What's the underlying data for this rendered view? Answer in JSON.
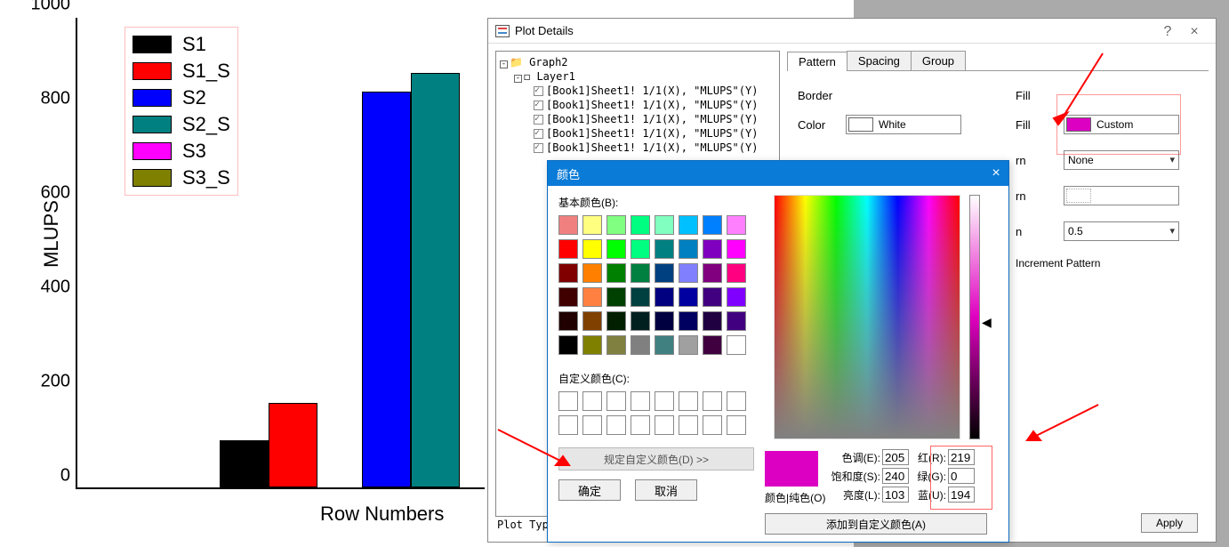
{
  "chart_data": {
    "type": "bar",
    "categories": [
      "S1",
      "S1_S",
      "S2",
      "S2_S",
      "S3",
      "S3_S"
    ],
    "series": [
      {
        "name": "S1",
        "value": 100,
        "color": "#000000"
      },
      {
        "name": "S1_S",
        "value": 180,
        "color": "#ff0000"
      },
      {
        "name": "S2",
        "value": 840,
        "color": "#0000ff"
      },
      {
        "name": "S2_S",
        "value": 880,
        "color": "#008080"
      },
      {
        "name": "S3",
        "value": null,
        "color": "#ff00ff"
      },
      {
        "name": "S3_S",
        "value": null,
        "color": "#808000"
      }
    ],
    "xlabel": "Row Numbers",
    "ylabel": "MLUPS",
    "ylim": [
      0,
      1000
    ],
    "yticks": [
      0,
      200,
      400,
      600,
      800,
      1000
    ]
  },
  "plot_details": {
    "title": "Plot Details",
    "tree": {
      "root": "Graph2",
      "layer": "Layer1",
      "items": [
        "[Book1]Sheet1! 1/1(X), \"MLUPS\"(Y)",
        "[Book1]Sheet1! 1/1(X), \"MLUPS\"(Y)",
        "[Book1]Sheet1! 1/1(X), \"MLUPS\"(Y)",
        "[Book1]Sheet1! 1/1(X), \"MLUPS\"(Y)",
        "[Book1]Sheet1! 1/1(X), \"MLUPS\"(Y)"
      ]
    },
    "tabs": [
      "Pattern",
      "Spacing",
      "Group"
    ],
    "active_tab": "Pattern",
    "border": {
      "title": "Border",
      "color_label": "Color",
      "color_value": "White",
      "color_hex": "#ffffff"
    },
    "fill": {
      "title": "Fill",
      "fill_label": "Fill",
      "fill_value": "Custom",
      "fill_hex": "#db00c2",
      "pattern_suffix": "rn",
      "pattern_value": "None",
      "pattern_density_suffix": "rn",
      "pattern_width_suffix": "n",
      "pattern_width_value": "0.5",
      "increment_label": "Increment Pattern"
    },
    "plot_type_label": "Plot Type",
    "apply": "Apply"
  },
  "color_dialog": {
    "title": "颜色",
    "basic_label": "基本颜色(B):",
    "basic_colors": [
      "#f08080",
      "#ffff80",
      "#80ff80",
      "#00ff80",
      "#80ffc0",
      "#00c0ff",
      "#0080ff",
      "#ff80ff",
      "#ff0000",
      "#ffff00",
      "#00ff00",
      "#00ff80",
      "#008080",
      "#0080c0",
      "#8000c0",
      "#ff00ff",
      "#800000",
      "#ff8000",
      "#008000",
      "#008040",
      "#004080",
      "#8080ff",
      "#800080",
      "#ff0080",
      "#400000",
      "#ff8040",
      "#004000",
      "#004040",
      "#000080",
      "#0000a0",
      "#400080",
      "#8000ff",
      "#200000",
      "#804000",
      "#002000",
      "#002020",
      "#000040",
      "#000060",
      "#200040",
      "#400080",
      "#000000",
      "#808000",
      "#808040",
      "#808080",
      "#408080",
      "#a0a0a0",
      "#400040",
      "#ffffff"
    ],
    "custom_label": "自定义颜色(C):",
    "define_btn": "规定自定义颜色(D) >>",
    "ok": "确定",
    "cancel": "取消",
    "preview_label": "颜色|纯色(O)",
    "hue_label": "色调(E):",
    "sat_label": "饱和度(S):",
    "lum_label": "亮度(L):",
    "red_label": "红(R):",
    "green_label": "绿(G):",
    "blue_label": "蓝(U):",
    "hue": "205",
    "sat": "240",
    "lum": "103",
    "red": "219",
    "green": "0",
    "blue": "194",
    "add_btn": "添加到自定义颜色(A)"
  }
}
